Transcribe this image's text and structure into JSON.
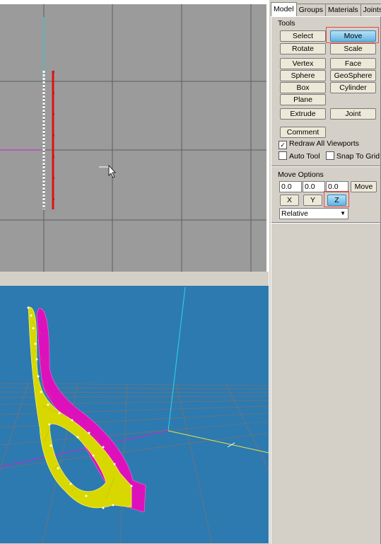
{
  "tabs": [
    {
      "label": "Model",
      "active": true
    },
    {
      "label": "Groups",
      "active": false
    },
    {
      "label": "Materials",
      "active": false
    },
    {
      "label": "Joints",
      "active": false
    }
  ],
  "tools": {
    "title": "Tools",
    "buttons": {
      "select": "Select",
      "move": "Move",
      "rotate": "Rotate",
      "scale": "Scale",
      "vertex": "Vertex",
      "face": "Face",
      "sphere": "Sphere",
      "geosphere": "GeoSphere",
      "box": "Box",
      "cylinder": "Cylinder",
      "plane": "Plane",
      "extrude": "Extrude",
      "joint": "Joint",
      "comment": "Comment"
    },
    "active_tool": "Move",
    "checkboxes": {
      "redraw_all": {
        "label": "Redraw All Viewports",
        "checked": true
      },
      "auto_tool": {
        "label": "Auto Tool",
        "checked": false
      },
      "snap_to_grid": {
        "label": "Snap To Grid",
        "checked": false
      }
    }
  },
  "move_options": {
    "title": "Move Options",
    "x_value": "0.0",
    "y_value": "0.0",
    "z_value": "0.0",
    "move_button": "Move",
    "axis_x": "X",
    "axis_y": "Y",
    "axis_z": "Z",
    "active_axis": "Z",
    "mode": "Relative"
  },
  "colors": {
    "top_viewport_bg": "#9b9b9b",
    "persp_viewport_bg": "#2d7ab0",
    "highlight_box": "#e8454f",
    "selected_button": "#61b6e4",
    "model_yellow": "#d8d800",
    "model_magenta": "#dd11bb",
    "vertex_red": "#e01010"
  }
}
